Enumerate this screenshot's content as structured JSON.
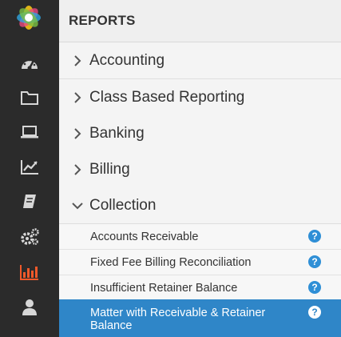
{
  "sidebar": {
    "icons": [
      "app-logo",
      "dashboard-icon",
      "folder-icon",
      "laptop-icon",
      "chart-line-icon",
      "book-icon",
      "gears-icon",
      "bar-chart-icon",
      "user-icon"
    ],
    "active_color": "#f0592a"
  },
  "header": {
    "title": "REPORTS"
  },
  "categories": [
    {
      "label": "Accounting"
    },
    {
      "label": "Class Based Reporting"
    },
    {
      "label": "Banking"
    },
    {
      "label": "Billing"
    },
    {
      "label": "Collection"
    }
  ],
  "collection_items": [
    {
      "label": "Accounts Receivable"
    },
    {
      "label": "Fixed Fee Billing Reconciliation"
    },
    {
      "label": "Insufficient Retainer Balance"
    },
    {
      "label": "Matter with Receivable & Retainer Balance"
    }
  ],
  "help_glyph": "?",
  "colors": {
    "accent": "#2f86c8",
    "rail_bg": "#2b2b2b"
  }
}
